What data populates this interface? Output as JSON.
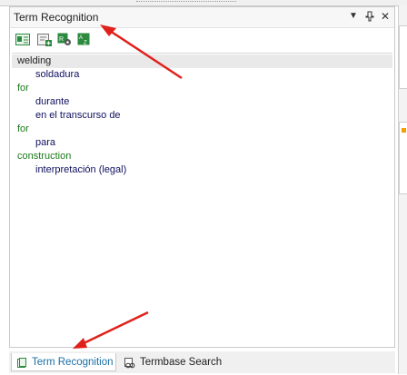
{
  "window": {
    "title": "Term Recognition"
  },
  "toolbar": {
    "icons": [
      "term-view-icon",
      "add-term-icon",
      "term-settings-icon",
      "sort-icon"
    ]
  },
  "results": [
    {
      "source": "welding",
      "targets": [
        "soldadura"
      ]
    },
    {
      "source": "for",
      "targets": [
        "durante",
        "en el transcurso de"
      ]
    },
    {
      "source": "for",
      "targets": [
        "para"
      ]
    },
    {
      "source": "construction",
      "targets": [
        "interpretación (legal)"
      ]
    }
  ],
  "tabs": [
    {
      "label": "Term Recognition",
      "active": true
    },
    {
      "label": "Termbase Search",
      "active": false
    }
  ],
  "colors": {
    "accent": "#1a6fa5",
    "source_term": "#1a7a1a",
    "target_term": "#101060",
    "annotation_arrow": "#e0211b"
  }
}
